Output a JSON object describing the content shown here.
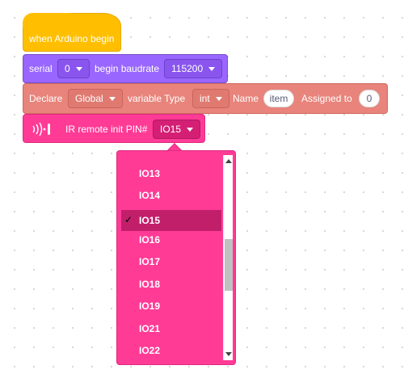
{
  "hat": {
    "label": "when Arduino begin"
  },
  "serial_block": {
    "label": "serial",
    "port": "0",
    "baud_label": "begin baudrate",
    "baud": "115200"
  },
  "declare_block": {
    "label": "Declare",
    "scope": "Global",
    "type_label": "variable Type",
    "type": "int",
    "name_label": "Name",
    "name_value": "item",
    "assign_label": "Assigned to",
    "assign_value": "0"
  },
  "ir_block": {
    "label": "IR remote init PIN#",
    "pin": "IO15"
  },
  "dropdown": {
    "check_mark": "✓",
    "selected": "IO15",
    "options": [
      "IO13",
      "IO14",
      "IO15",
      "IO16",
      "IO17",
      "IO18",
      "IO19",
      "IO21",
      "IO22"
    ]
  },
  "colors": {
    "hat": "#ffbf00",
    "serial": "#9966ff",
    "declare": "#e8847b",
    "ir": "#ff3b96",
    "selected_option": "#c21f6b"
  }
}
